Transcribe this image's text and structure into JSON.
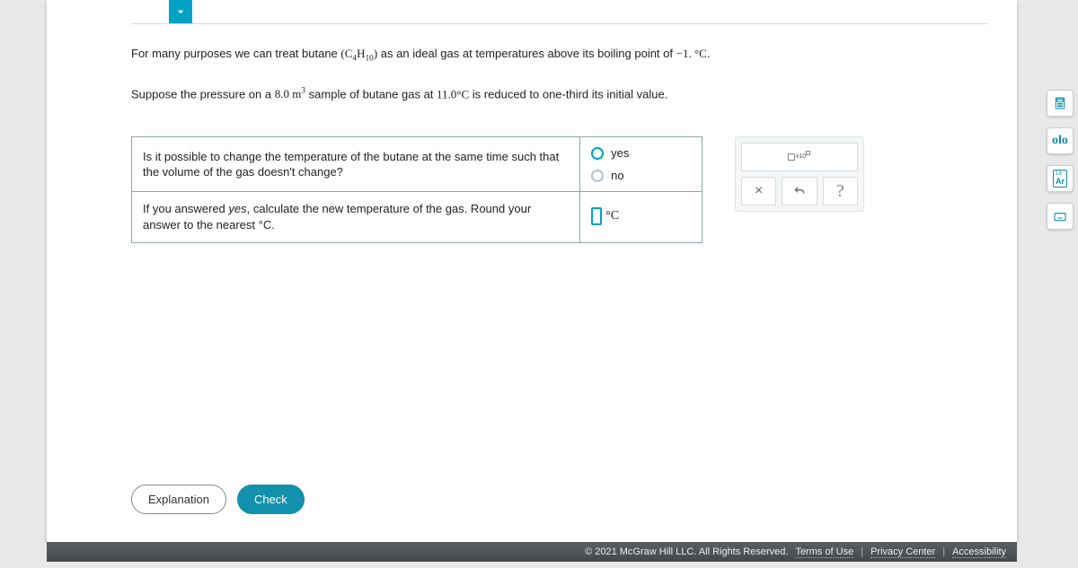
{
  "problem": {
    "line1_a": "For many purposes we can treat butane ",
    "line1_b": " as an ideal gas at temperatures above its boiling point of ",
    "line1_c": ".",
    "formula_base": "C",
    "formula_sub1": "4",
    "formula_mid": "H",
    "formula_sub2": "10",
    "bp_sign": "−",
    "bp_val": "1.",
    "bp_unit": "°C",
    "line2_a": "Suppose the pressure on a ",
    "line2_vol": "8.0",
    "line2_unit": "m",
    "line2_exp": "3",
    "line2_b": " sample of butane gas at ",
    "line2_temp": "11.0°C",
    "line2_c": " is reduced to one-third its initial value."
  },
  "q1": {
    "prompt": "Is it possible to change the temperature of the butane at the same time such that the volume of the gas doesn't change?",
    "opt_yes": "yes",
    "opt_no": "no"
  },
  "q2": {
    "prompt_a": "If you answered ",
    "prompt_em": "yes",
    "prompt_b": ", calculate the new temperature of the gas. Round your answer to the nearest °C.",
    "unit": "°C"
  },
  "toolbox": {
    "sci_label": "x10",
    "close": "×",
    "help": "?"
  },
  "side": {
    "calc": "calculator-icon",
    "stats": "olo",
    "element": "Ar",
    "keyboard": "keyboard-icon"
  },
  "buttons": {
    "explanation": "Explanation",
    "check": "Check"
  },
  "footer": {
    "copyright": "© 2021 McGraw Hill LLC. All Rights Reserved.",
    "terms": "Terms of Use",
    "privacy": "Privacy Center",
    "access": "Accessibility"
  }
}
